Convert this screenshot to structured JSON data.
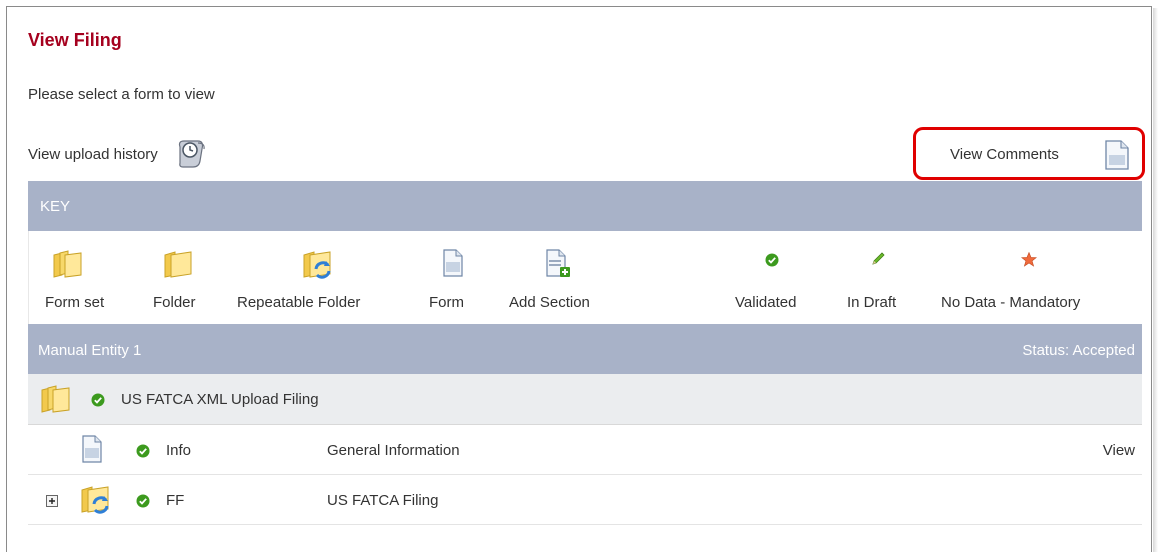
{
  "page": {
    "title": "View Filing",
    "subtitle": "Please select a form to view",
    "upload_history_label": "View upload history",
    "view_comments_label": "View Comments"
  },
  "key": {
    "header": "KEY",
    "items": [
      {
        "label": "Form set",
        "icon": "form-set-icon"
      },
      {
        "label": "Folder",
        "icon": "folder-icon"
      },
      {
        "label": "Repeatable Folder",
        "icon": "repeatable-folder-icon"
      },
      {
        "label": "Form",
        "icon": "form-icon"
      },
      {
        "label": "Add Section",
        "icon": "add-section-icon"
      },
      {
        "label": "Validated",
        "icon": "validated-check-icon"
      },
      {
        "label": "In Draft",
        "icon": "pencil-icon"
      },
      {
        "label": "No Data - Mandatory",
        "icon": "star-icon"
      }
    ]
  },
  "entity": {
    "name": "Manual Entity 1",
    "status": "Status: Accepted",
    "filing": {
      "name": "US FATCA XML Upload Filing"
    },
    "rows": [
      {
        "code": "Info",
        "description": "General Information",
        "action": "View"
      },
      {
        "code": "FF",
        "description": "US FATCA Filing",
        "action": ""
      }
    ]
  },
  "colors": {
    "title": "#a5001e",
    "header_bg": "#a8b2c8",
    "highlight_border": "#e00000",
    "validated": "#3c9a1e"
  }
}
